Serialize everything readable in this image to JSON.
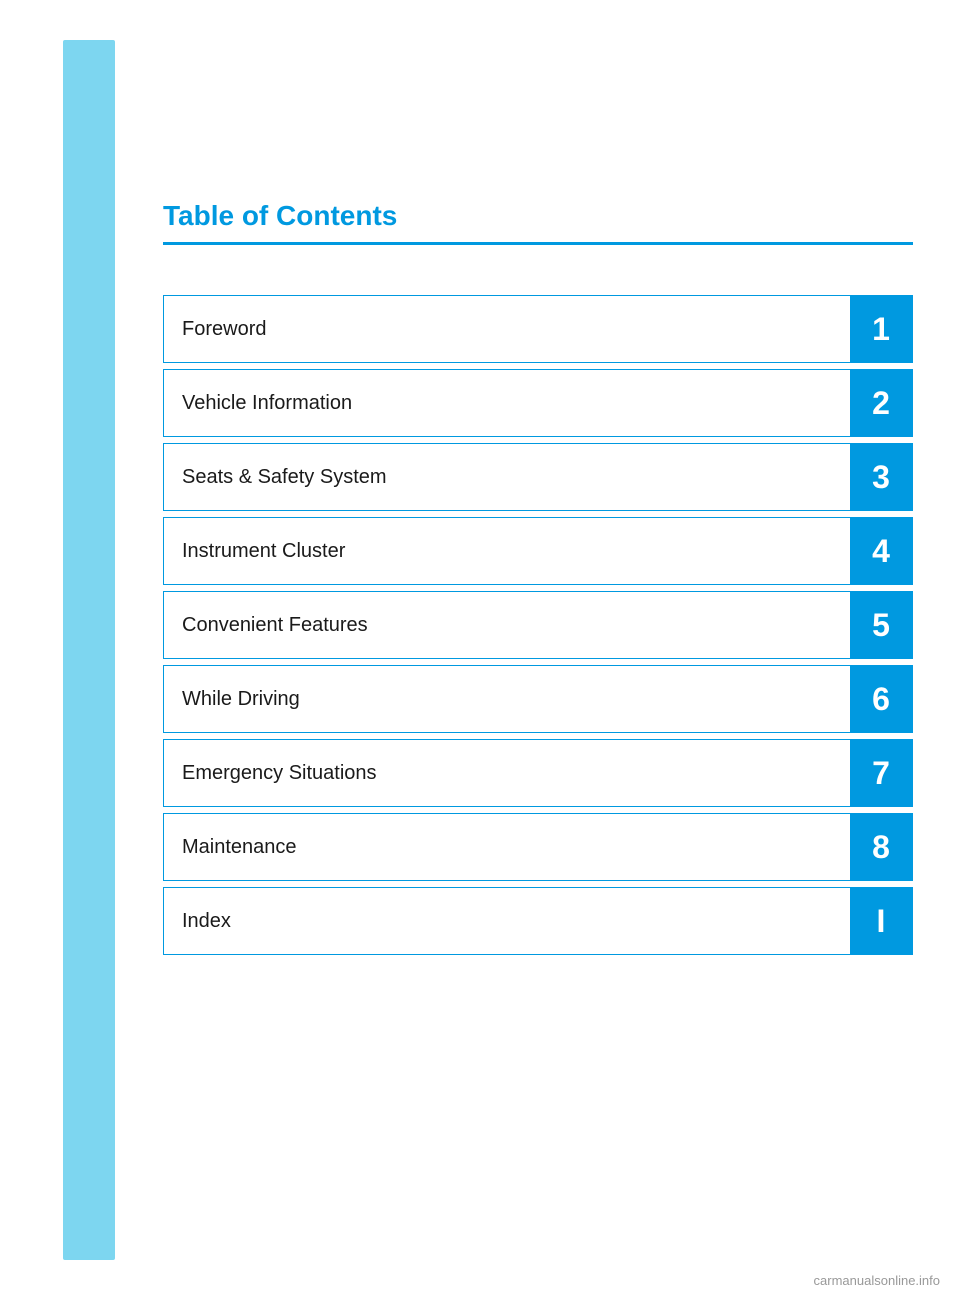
{
  "page": {
    "title": "Table of Contents",
    "accent_color": "#0099e0",
    "light_blue": "#7dd6f0"
  },
  "toc": {
    "items": [
      {
        "label": "Foreword",
        "number": "1"
      },
      {
        "label": "Vehicle Information",
        "number": "2"
      },
      {
        "label": "Seats & Safety System",
        "number": "3"
      },
      {
        "label": "Instrument Cluster",
        "number": "4"
      },
      {
        "label": "Convenient Features",
        "number": "5"
      },
      {
        "label": "While Driving",
        "number": "6"
      },
      {
        "label": "Emergency Situations",
        "number": "7"
      },
      {
        "label": "Maintenance",
        "number": "8"
      },
      {
        "label": "Index",
        "number": "I"
      }
    ]
  },
  "footer": {
    "watermark": "carmanualsonline.info"
  }
}
